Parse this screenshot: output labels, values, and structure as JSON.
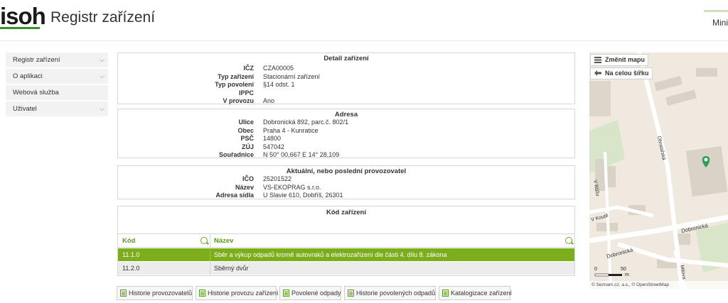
{
  "header": {
    "logo": "isoh",
    "title": "Registr zařízení",
    "right_label": "Mini"
  },
  "sidebar": {
    "items": [
      {
        "label": "Registr zařízení",
        "chevron": true
      },
      {
        "label": "O aplikaci",
        "chevron": true
      },
      {
        "label": "Webová služba",
        "chevron": false
      },
      {
        "label": "Uživatel",
        "chevron": true
      }
    ]
  },
  "detail": {
    "title": "Detail zařízení",
    "rows": [
      {
        "label": "IČZ",
        "value": "CZA00005"
      },
      {
        "label": "Typ zařízení",
        "value": "Stacionární zařízení"
      },
      {
        "label": "Typ povolení",
        "value": "§14 odst. 1"
      },
      {
        "label": "IPPC",
        "value": ""
      },
      {
        "label": "V provozu",
        "value": "Ano"
      }
    ]
  },
  "address": {
    "title": "Adresa",
    "rows": [
      {
        "label": "Ulice",
        "value": "Dobronická 892, parc.č. 802/1"
      },
      {
        "label": "Obec",
        "value": "Praha 4 - Kunratice"
      },
      {
        "label": "PSČ",
        "value": "14800"
      },
      {
        "label": "ZÚJ",
        "value": "547042"
      },
      {
        "label": "Souřadnice",
        "value": "N 50° 00,667 E 14° 28,109"
      }
    ]
  },
  "operator": {
    "title": "Aktuální, nebo poslední provozovatel",
    "rows": [
      {
        "label": "IČO",
        "value": "25201522"
      },
      {
        "label": "Název",
        "value": "VS-EKOPRAG s.r.o."
      },
      {
        "label": "Adresa sídla",
        "value": "U Slavie 610, Dobříš, 26301"
      }
    ]
  },
  "codes": {
    "title": "Kód zařízení",
    "col_code": "Kód",
    "col_name": "Název",
    "rows": [
      {
        "code": "11.1.0",
        "name": "Sběr a výkup odpadů kromě autovraků a elektrozařízení dle části 4. dílu 8. zákona",
        "selected": true
      },
      {
        "code": "11.2.0",
        "name": "Sběrný dvůr",
        "selected": false
      }
    ]
  },
  "buttons": [
    {
      "label": "Historie provozovatelů"
    },
    {
      "label": "Historie provozu zařízení"
    },
    {
      "label": "Povolené odpady"
    },
    {
      "label": "Historie povolených odpadů"
    },
    {
      "label": "Katalogizace zařízení"
    }
  ],
  "map": {
    "change_map": "Změnit mapu",
    "full_width": "Na celou šířku",
    "streets": {
      "obratarska": "Obratařská",
      "v_ruzi": "V Růžu",
      "v_koute": "V Koutě",
      "dobronicka1": "Dobronická",
      "dobronicka2": "Dobronická",
      "milova": "Milova"
    },
    "scale_0": "0",
    "scale_50": "50",
    "scale_unit": "m",
    "attribution": "© Seznam.cz, a.s., © OpenStreetMap",
    "marker_color": "#2e9e55"
  },
  "colors": {
    "accent": "#7cae1c",
    "brand_green": "#3e8e2e"
  }
}
